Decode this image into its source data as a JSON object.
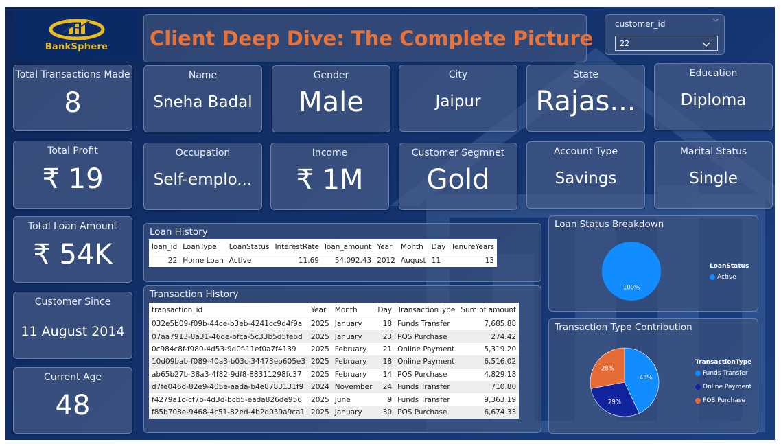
{
  "colors": {
    "title": "#e8733a",
    "active": "#118dff",
    "funds_transfer": "#118dff",
    "online_payment": "#12239e",
    "pos_purchase": "#e66c37",
    "logo_gold": "#e8b923"
  },
  "header": {
    "logo_text": "BankSphere",
    "logo_icon": "bank-chart-logo-icon",
    "title": "Client Deep Dive: The Complete Picture"
  },
  "slicer": {
    "label": "customer_id",
    "value": "22",
    "icon": "chevron-down-icon"
  },
  "kpis": {
    "transactions": {
      "label": "Total Transactions Made",
      "value": "8"
    },
    "profit": {
      "label": "Total Profit",
      "value": "₹ 19"
    },
    "loan_amount": {
      "label": "Total Loan Amount",
      "value": "₹ 54K"
    },
    "customer_since": {
      "label": "Customer Since",
      "value": "11 August 2014"
    },
    "age": {
      "label": "Current Age",
      "value": "48"
    }
  },
  "profile": {
    "name": {
      "label": "Name",
      "value": "Sneha Badal"
    },
    "gender": {
      "label": "Gender",
      "value": "Male"
    },
    "city": {
      "label": "City",
      "value": "Jaipur"
    },
    "state": {
      "label": "State",
      "value": "Rajas..."
    },
    "education": {
      "label": "Education",
      "value": "Diploma"
    },
    "occupation": {
      "label": "Occupation",
      "value": "Self-emplo..."
    },
    "income": {
      "label": "Income",
      "value": "₹ 1M"
    },
    "segment": {
      "label": "Customer Segmnet",
      "value": "Gold"
    },
    "account_type": {
      "label": "Account Type",
      "value": "Savings"
    },
    "marital_status": {
      "label": "Marital Status",
      "value": "Single"
    }
  },
  "loan_history": {
    "title": "Loan History",
    "columns": [
      "loan_id",
      "LoanType",
      "LoanStatus",
      "InterestRate",
      "loan_amount",
      "Year",
      "Month",
      "Day",
      "TenureYears"
    ],
    "rows": [
      [
        "22",
        "Home Loan",
        "Active",
        "11.69",
        "54,092.43",
        "2012",
        "August",
        "11",
        "13"
      ]
    ]
  },
  "transaction_history": {
    "title": "Transaction History",
    "columns": [
      "transaction_id",
      "Year",
      "Month",
      "Day",
      "TransactionType",
      "Sum of amount"
    ],
    "rows": [
      [
        "032e5b09-f09b-44ce-b3eb-4241cc9d4f9a",
        "2025",
        "January",
        "18",
        "Funds Transfer",
        "7,685.88"
      ],
      [
        "07aa7913-8a31-46de-bfca-5c33b5d5febd",
        "2025",
        "January",
        "23",
        "POS Purchase",
        "274.42"
      ],
      [
        "0c984c8f-f980-4d53-9d0f-11ef0a7f4139",
        "2025",
        "February",
        "21",
        "Online Payment",
        "5,319.20"
      ],
      [
        "10d09bab-f089-40a3-b03c-34473eb605e3",
        "2025",
        "February",
        "18",
        "Online Payment",
        "6,516.02"
      ],
      [
        "ab65b27b-38a3-4f82-9df8-88311298fc37",
        "2025",
        "February",
        "14",
        "POS Purchase",
        "4,829.18"
      ],
      [
        "d7fe046d-82e9-405e-aada-b4e8783131f9",
        "2024",
        "November",
        "24",
        "Funds Transfer",
        "710.80"
      ],
      [
        "f4279a1c-cf7b-4d3d-bcb5-eada826de956",
        "2025",
        "June",
        "9",
        "Funds Transfer",
        "9,363.19"
      ],
      [
        "f85b708e-9468-4c51-82ed-4b2d059a9ca1",
        "2025",
        "January",
        "30",
        "POS Purchase",
        "6,674.33"
      ]
    ]
  },
  "loan_status_chart": {
    "title": "Loan Status Breakdown",
    "legend_title": "LoanStatus",
    "slices": [
      {
        "name": "Active",
        "value": 100,
        "label": "100%",
        "color": "#118dff"
      }
    ]
  },
  "transaction_type_chart": {
    "title": "Transaction Type Contribution",
    "legend_title": "TransactionType",
    "slices": [
      {
        "name": "Funds Transfer",
        "value": 43,
        "label": "43%",
        "color": "#118dff"
      },
      {
        "name": "Online Payment",
        "value": 29,
        "label": "29%",
        "color": "#12239e"
      },
      {
        "name": "POS Purchase",
        "value": 28,
        "label": "28%",
        "color": "#e66c37"
      }
    ]
  }
}
